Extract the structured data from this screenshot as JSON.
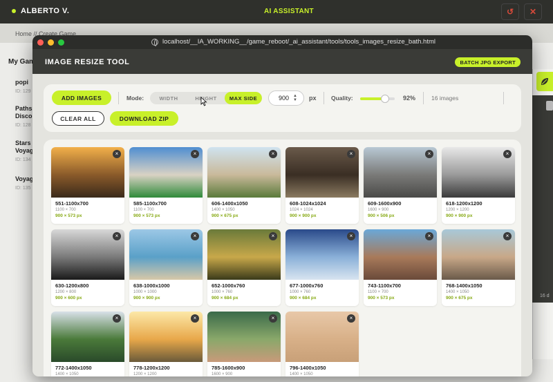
{
  "background_app": {
    "user_name": "ALBERTO V.",
    "assistant_title": "AI ASSISTANT",
    "breadcrumb": "Home // Create Game",
    "sidebar_title": "My Gam",
    "items": [
      {
        "title": "popi",
        "id": "ID: 129"
      },
      {
        "title": "Paths\nDisco",
        "id": "ID: 128"
      },
      {
        "title": "Stars\nVoyag",
        "id": "ID: 134"
      },
      {
        "title": "Voyag",
        "id": "ID: 135"
      }
    ],
    "right_text": "16 d"
  },
  "browser": {
    "url": "localhost/__IA_WORKING__/game_reboot/_ai_assistant/tools/tools_images_resize_bath.html"
  },
  "app": {
    "title": "IMAGE RESIZE TOOL",
    "batch_export_label": "BATCH JPG EXPORT"
  },
  "toolbar": {
    "add_images_label": "ADD IMAGES",
    "clear_all_label": "CLEAR ALL",
    "download_zip_label": "DOWNLOAD ZIP",
    "mode_label": "Mode:",
    "modes": [
      "WIDTH",
      "HEIGHT",
      "MAX SIDE"
    ],
    "selected_mode": "MAX SIDE",
    "size_value": "900",
    "size_unit": "px",
    "quality_label": "Quality:",
    "quality_value": "92%",
    "quality_fraction": 0.72,
    "image_count": "16 images"
  },
  "images": [
    {
      "name": "551-1100x700",
      "orig": "1100 × 700",
      "out": "900 × 573 px",
      "thumb_colors": [
        "#f2b04a",
        "#8a5a2a",
        "#3a2a1a"
      ]
    },
    {
      "name": "585-1100x700",
      "orig": "1100 × 700",
      "out": "900 × 573 px",
      "thumb_colors": [
        "#4f8ed1",
        "#d9d2c4",
        "#2f8a3a"
      ]
    },
    {
      "name": "606-1400x1050",
      "orig": "1400 × 1050",
      "out": "900 × 675 px",
      "thumb_colors": [
        "#cfe3ef",
        "#c9b99a",
        "#5a7a3a"
      ]
    },
    {
      "name": "608-1024x1024",
      "orig": "1024 × 1024",
      "out": "900 × 900 px",
      "thumb_colors": [
        "#6a5a4a",
        "#3a2e24",
        "#8a7a60"
      ]
    },
    {
      "name": "609-1600x900",
      "orig": "1600 × 900",
      "out": "900 × 506 px",
      "thumb_colors": [
        "#b8c8d4",
        "#7a7a78",
        "#4a4a48"
      ]
    },
    {
      "name": "618-1200x1200",
      "orig": "1200 × 1200",
      "out": "900 × 900 px",
      "thumb_colors": [
        "#e8e8e8",
        "#9a9a9a",
        "#3a3a3a"
      ]
    },
    {
      "name": "630-1200x800",
      "orig": "1200 × 800",
      "out": "900 × 600 px",
      "thumb_colors": [
        "#d8d8d8",
        "#7a7a7a",
        "#1a1a1a"
      ]
    },
    {
      "name": "638-1000x1000",
      "orig": "1000 × 1000",
      "out": "900 × 900 px",
      "thumb_colors": [
        "#9cc8e6",
        "#5aa0c8",
        "#d8c8a8"
      ]
    },
    {
      "name": "652-1000x760",
      "orig": "1000 × 760",
      "out": "900 × 684 px",
      "thumb_colors": [
        "#6a7a3a",
        "#c8a84a",
        "#3a3a1a"
      ]
    },
    {
      "name": "677-1000x760",
      "orig": "1000 × 760",
      "out": "900 × 684 px",
      "thumb_colors": [
        "#2a4a8a",
        "#8ab0d8",
        "#d8e4f0"
      ]
    },
    {
      "name": "743-1100x700",
      "orig": "1100 × 700",
      "out": "900 × 573 px",
      "thumb_colors": [
        "#6aa8d8",
        "#a87a5a",
        "#6a4a3a"
      ]
    },
    {
      "name": "768-1400x1050",
      "orig": "1400 × 1050",
      "out": "900 × 675 px",
      "thumb_colors": [
        "#a8c8d8",
        "#c8a888",
        "#6a5a4a"
      ]
    },
    {
      "name": "772-1400x1050",
      "orig": "1400 × 1050",
      "out": "",
      "thumb_colors": [
        "#d8e0e8",
        "#4a7a3a",
        "#2a4a2a"
      ]
    },
    {
      "name": "778-1200x1200",
      "orig": "1200 × 1200",
      "out": "",
      "thumb_colors": [
        "#fce8a8",
        "#e8a84a",
        "#6a5a3a"
      ]
    },
    {
      "name": "785-1600x900",
      "orig": "1600 × 900",
      "out": "",
      "thumb_colors": [
        "#3a6a4a",
        "#8aa86a",
        "#c89a7a"
      ]
    },
    {
      "name": "796-1400x1050",
      "orig": "1400 × 1050",
      "out": "",
      "thumb_colors": [
        "#e8c8a8",
        "#d8b088",
        "#c8a078"
      ]
    }
  ],
  "colors": {
    "accent": "#c8f02a",
    "header_dark": "#3a3b37",
    "output_size_text": "#86a913"
  }
}
